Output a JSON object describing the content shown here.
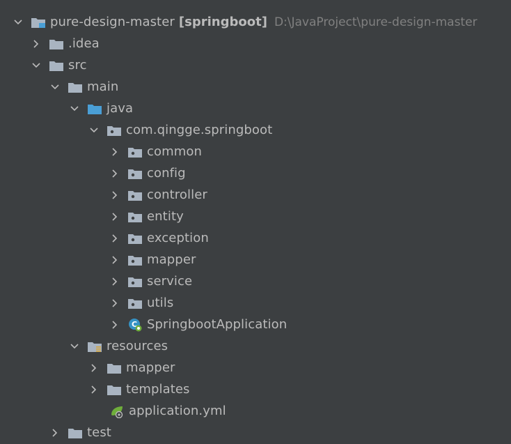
{
  "tree": {
    "root": {
      "name": "pure-design-master",
      "module": "[springboot]",
      "path": "D:\\JavaProject\\pure-design-master"
    },
    "nodes": [
      {
        "label": ".idea"
      },
      {
        "label": "src"
      },
      {
        "label": "main"
      },
      {
        "label": "java"
      },
      {
        "label": "com.qingge.springboot"
      },
      {
        "label": "common"
      },
      {
        "label": "config"
      },
      {
        "label": "controller"
      },
      {
        "label": "entity"
      },
      {
        "label": "exception"
      },
      {
        "label": "mapper"
      },
      {
        "label": "service"
      },
      {
        "label": "utils"
      },
      {
        "label": "SpringbootApplication"
      },
      {
        "label": "resources"
      },
      {
        "label": "mapper"
      },
      {
        "label": "templates"
      },
      {
        "label": "application.yml"
      },
      {
        "label": "test"
      }
    ]
  },
  "colors": {
    "background": "#3c3f41",
    "text": "#bbbbbb",
    "path_text": "#808080",
    "folder": "#a9b4c1",
    "source_folder": "#4a9fd6",
    "spring": "#6fae3b",
    "class_icon": "#3592c4"
  }
}
